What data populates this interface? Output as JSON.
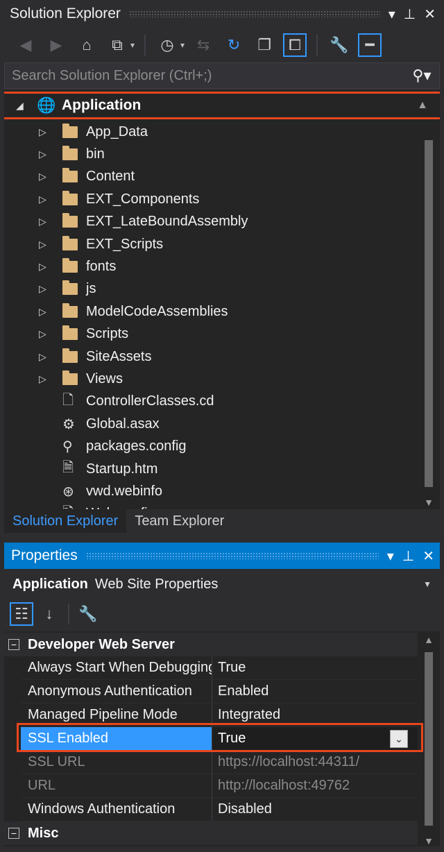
{
  "solution_explorer": {
    "title": "Solution Explorer",
    "search_placeholder": "Search Solution Explorer (Ctrl+;)",
    "root": {
      "label": "Application"
    },
    "items": [
      {
        "label": "App_Data",
        "type": "folder"
      },
      {
        "label": "bin",
        "type": "folder"
      },
      {
        "label": "Content",
        "type": "folder"
      },
      {
        "label": "EXT_Components",
        "type": "folder"
      },
      {
        "label": "EXT_LateBoundAssembly",
        "type": "folder"
      },
      {
        "label": "EXT_Scripts",
        "type": "folder"
      },
      {
        "label": "fonts",
        "type": "folder"
      },
      {
        "label": "js",
        "type": "folder"
      },
      {
        "label": "ModelCodeAssemblies",
        "type": "folder"
      },
      {
        "label": "Scripts",
        "type": "folder"
      },
      {
        "label": "SiteAssets",
        "type": "folder"
      },
      {
        "label": "Views",
        "type": "folder"
      },
      {
        "label": "ControllerClasses.cd",
        "type": "file"
      },
      {
        "label": "Global.asax",
        "type": "file"
      },
      {
        "label": "packages.config",
        "type": "file"
      },
      {
        "label": "Startup.htm",
        "type": "file"
      },
      {
        "label": "vwd.webinfo",
        "type": "file"
      },
      {
        "label": "Web.config",
        "type": "file"
      }
    ],
    "tabs": [
      "Solution Explorer",
      "Team Explorer"
    ]
  },
  "properties": {
    "title": "Properties",
    "object_name": "Application",
    "object_type": "Web Site Properties",
    "category1": "Developer Web Server",
    "rows": [
      {
        "name": "Always Start When Debugging",
        "value": "True"
      },
      {
        "name": "Anonymous Authentication",
        "value": "Enabled"
      },
      {
        "name": "Managed Pipeline Mode",
        "value": "Integrated"
      },
      {
        "name": "SSL Enabled",
        "value": "True"
      },
      {
        "name": "SSL URL",
        "value": "https://localhost:44311/"
      },
      {
        "name": "URL",
        "value": "http://localhost:49762"
      },
      {
        "name": "Windows Authentication",
        "value": "Disabled"
      }
    ],
    "category2": "Misc"
  },
  "colors": {
    "accent": "#007acc",
    "highlight": "#e8461d",
    "folder": "#dcb67a",
    "selection": "#3399ff"
  }
}
